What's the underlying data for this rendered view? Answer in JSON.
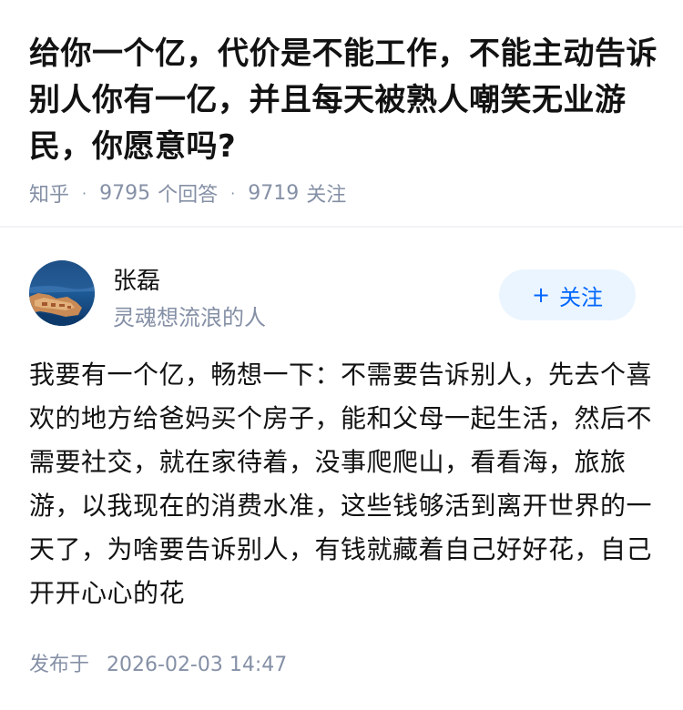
{
  "question": {
    "title": "给你一个亿，代价是不能工作，不能主动告诉别人你有一亿，并且每天被熟人嘲笑无业游民，你愿意吗?",
    "source": "知乎",
    "answer_count": "9795",
    "answer_count_label": "个回答",
    "follower_count": "9719",
    "follower_label": "关注"
  },
  "author": {
    "name": "张磊",
    "bio": "灵魂想流浪的人",
    "follow_button_icon": "+",
    "follow_button_label": "关注",
    "avatar_icon": "coastal-town-photo"
  },
  "answer": {
    "content": "我要有一个亿，畅想一下：不需要告诉别人，先去个喜欢的地方给爸妈买个房子，能和父母一起生活，然后不需要社交，就在家待着，没事爬爬山，看看海，旅旅游，以我现在的消费水准，这些钱够活到离开世界的一天了，为啥要告诉别人，有钱就藏着自己好好花，自己开开心心的花",
    "published_label": "发布于",
    "published_time": "2026-02-03 14:47"
  },
  "colors": {
    "title": "#121212",
    "meta": "#8590a6",
    "accent": "#0066ff",
    "follow_bg": "#ebf5ff"
  }
}
